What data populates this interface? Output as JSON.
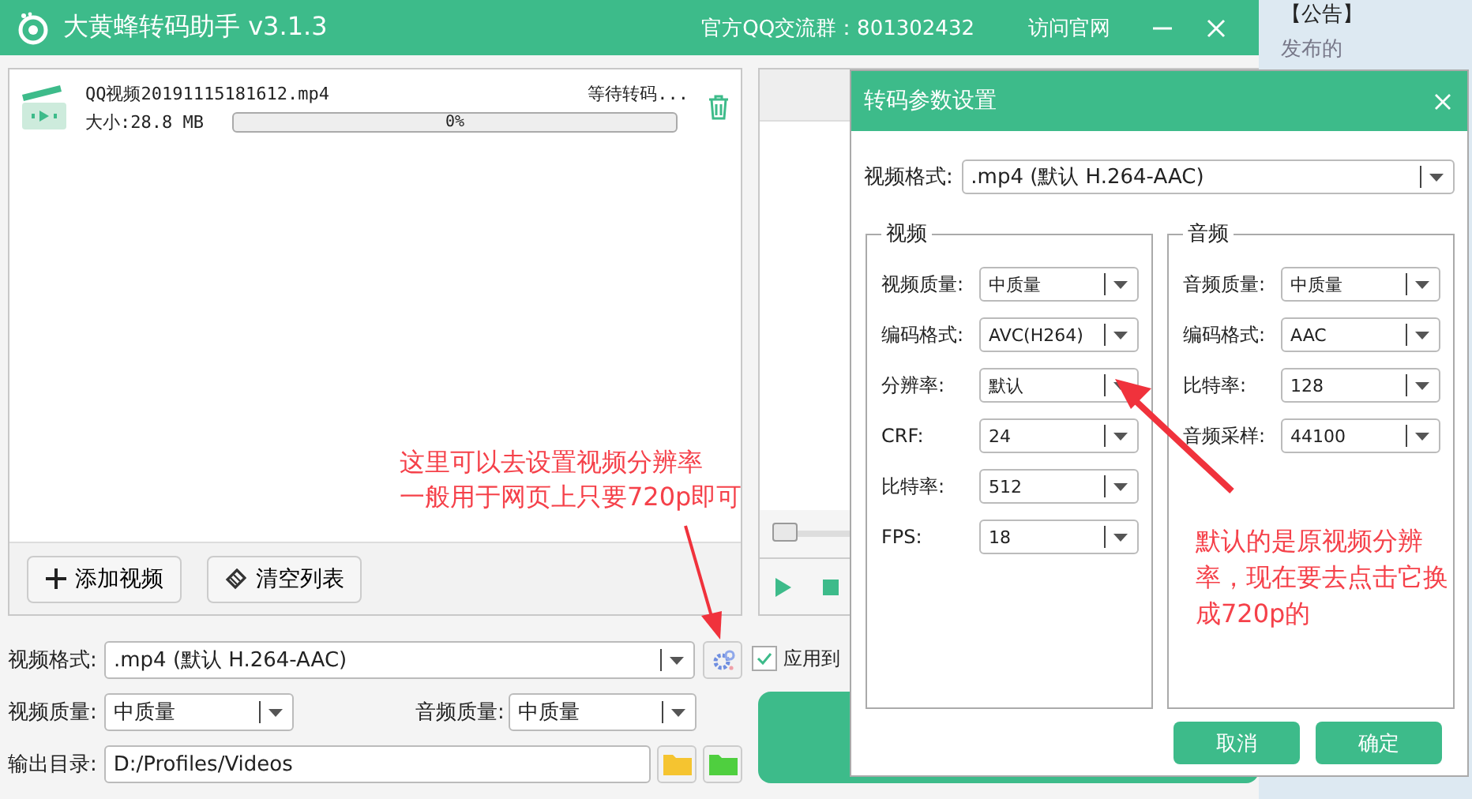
{
  "window": {
    "title": "大黄蜂转码助手 v3.1.3",
    "qq_group": "官方QQ交流群：801302432",
    "website_link": "访问官网"
  },
  "files": [
    {
      "name": "QQ视频20191115181612.mp4",
      "status": "等待转码...",
      "size": "大小:28.8 MB",
      "progress": "0%",
      "level": 0
    }
  ],
  "list_buttons": [
    {
      "kind": "add",
      "label": "添加视频"
    },
    {
      "kind": "clear",
      "label": "清空列表"
    }
  ],
  "preview": {
    "level": 0
  },
  "settings": {
    "format": {
      "label": "视频格式:",
      "value": ".mp4 (默认 H.264-AAC)"
    },
    "video_quality": {
      "label": "视频质量:",
      "value": "中质量"
    },
    "audio_quality": {
      "label": "音频质量:",
      "value": "中质量"
    },
    "output_dir": {
      "label": "输出目录:",
      "value": "D:/Profiles/Videos"
    }
  },
  "apply_all": {
    "label": "应用到",
    "checked": true
  },
  "notice": {
    "title": "【公告】",
    "text": "发布的"
  },
  "dialog": {
    "title": "转码参数设置",
    "format": {
      "label": "视频格式:",
      "value": ".mp4 (默认 H.264-AAC)"
    },
    "groups": [
      {
        "title": "视频",
        "rows": [
          {
            "label": "视频质量:",
            "value": "中质量"
          },
          {
            "label": "编码格式:",
            "value": "AVC(H264)"
          },
          {
            "label": "分辨率:",
            "value": "默认"
          },
          {
            "label": "CRF:",
            "value": "24"
          },
          {
            "label": "比特率:",
            "value": "512"
          },
          {
            "label": "FPS:",
            "value": "18"
          }
        ]
      },
      {
        "title": "音频",
        "rows": [
          {
            "label": "音频质量:",
            "value": "中质量"
          },
          {
            "label": "编码格式:",
            "value": "AAC"
          },
          {
            "label": "比特率:",
            "value": "128"
          },
          {
            "label": "音频采样:",
            "value": "44100"
          }
        ]
      }
    ],
    "buttons": [
      "取消",
      "确定"
    ]
  },
  "annotations": [
    {
      "lines": [
        "这里可以去设置视频分辨率",
        "一般用于网页上只要720p即可"
      ]
    },
    {
      "lines": [
        "默认的是原视频分辨",
        "率，现在要去点击它换",
        "成720p的"
      ]
    }
  ]
}
